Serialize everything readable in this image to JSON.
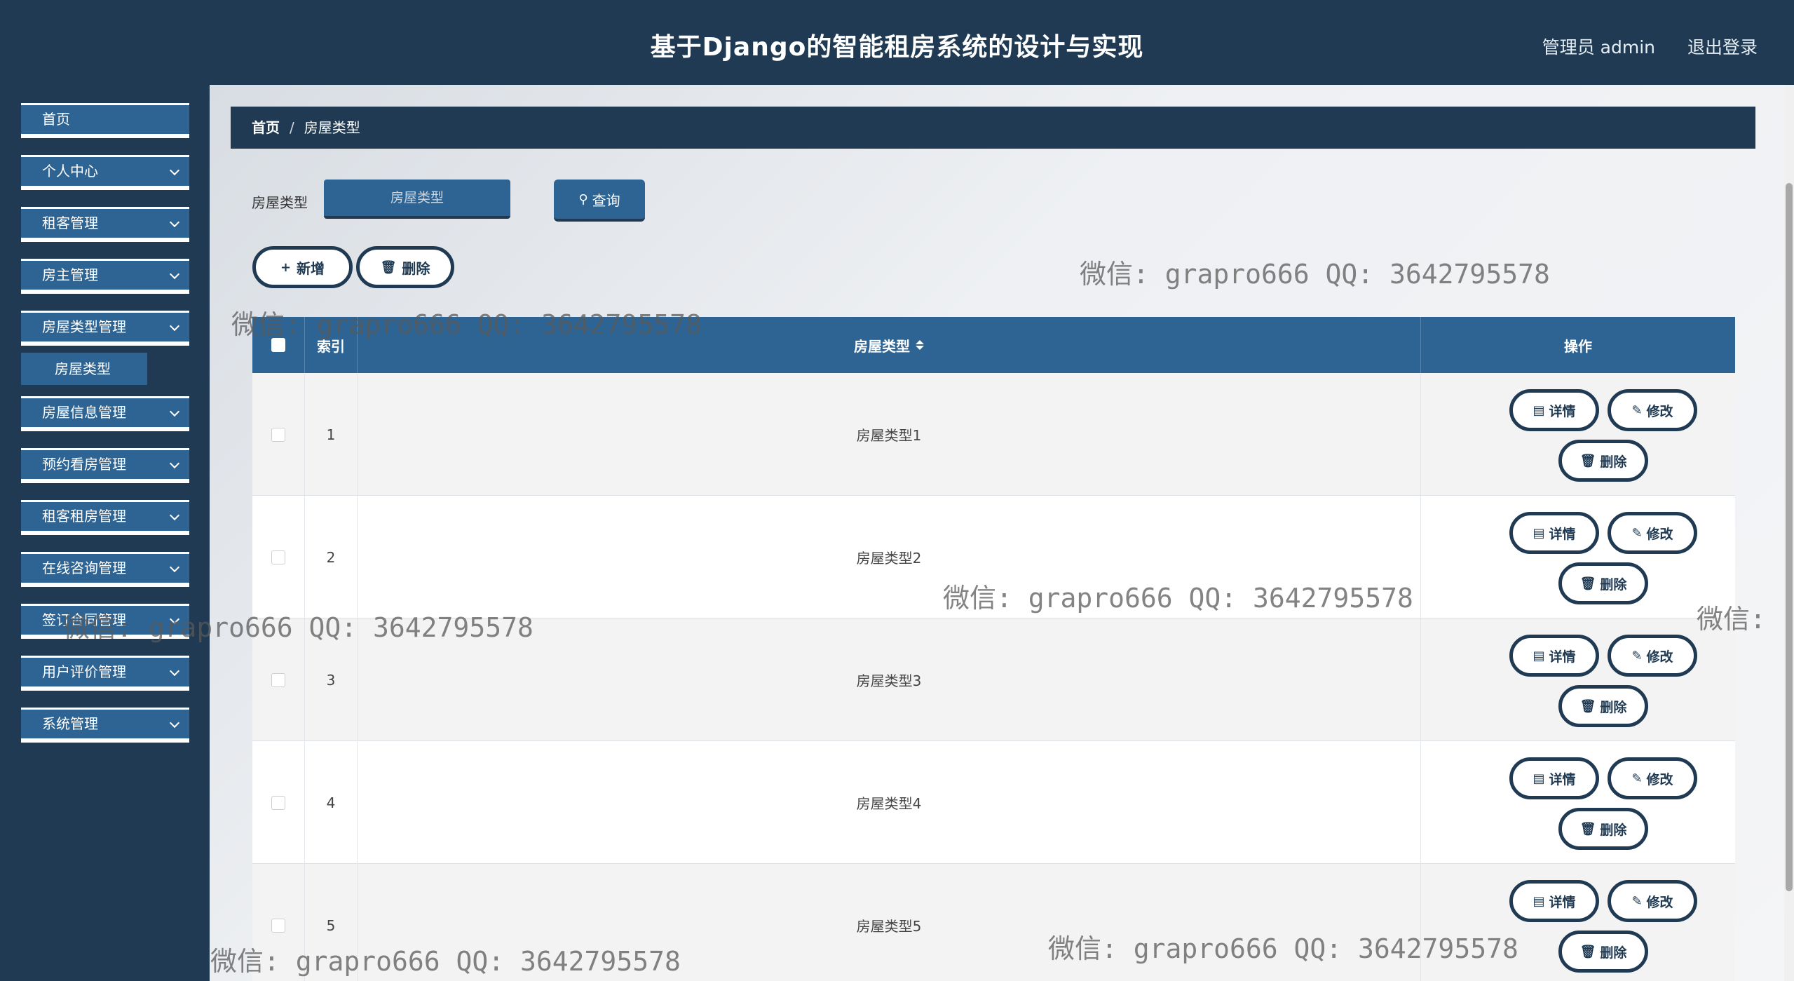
{
  "header": {
    "title": "基于Django的智能租房系统的设计与实现",
    "user": "管理员 admin",
    "logout": "退出登录"
  },
  "sidebar": {
    "items": [
      {
        "label": "首页",
        "has_children": false
      },
      {
        "label": "个人中心",
        "has_children": true
      },
      {
        "label": "租客管理",
        "has_children": true
      },
      {
        "label": "房主管理",
        "has_children": true
      },
      {
        "label": "房屋类型管理",
        "has_children": true
      },
      {
        "label": "房屋信息管理",
        "has_children": true
      },
      {
        "label": "预约看房管理",
        "has_children": true
      },
      {
        "label": "租客租房管理",
        "has_children": true
      },
      {
        "label": "在线咨询管理",
        "has_children": true
      },
      {
        "label": "签订合同管理",
        "has_children": true
      },
      {
        "label": "用户评价管理",
        "has_children": true
      },
      {
        "label": "系统管理",
        "has_children": true
      }
    ],
    "submenu": {
      "label": "房屋类型"
    }
  },
  "breadcrumb": {
    "home": "首页",
    "sep": "/",
    "current": "房屋类型"
  },
  "search": {
    "label": "房屋类型",
    "placeholder": "房屋类型",
    "button": "查询"
  },
  "actions": {
    "add": "新增",
    "delete": "删除"
  },
  "table": {
    "headers": {
      "index": "索引",
      "type": "房屋类型",
      "ops": "操作"
    },
    "rows": [
      {
        "index": "1",
        "type": "房屋类型1"
      },
      {
        "index": "2",
        "type": "房屋类型2"
      },
      {
        "index": "3",
        "type": "房屋类型3"
      },
      {
        "index": "4",
        "type": "房屋类型4"
      },
      {
        "index": "5",
        "type": "房屋类型5"
      }
    ],
    "ops": {
      "detail": "详情",
      "edit": "修改",
      "delete": "删除"
    }
  },
  "watermark": "微信: grapro666 QQ: 3642795578",
  "watermark_partial": "微信:"
}
